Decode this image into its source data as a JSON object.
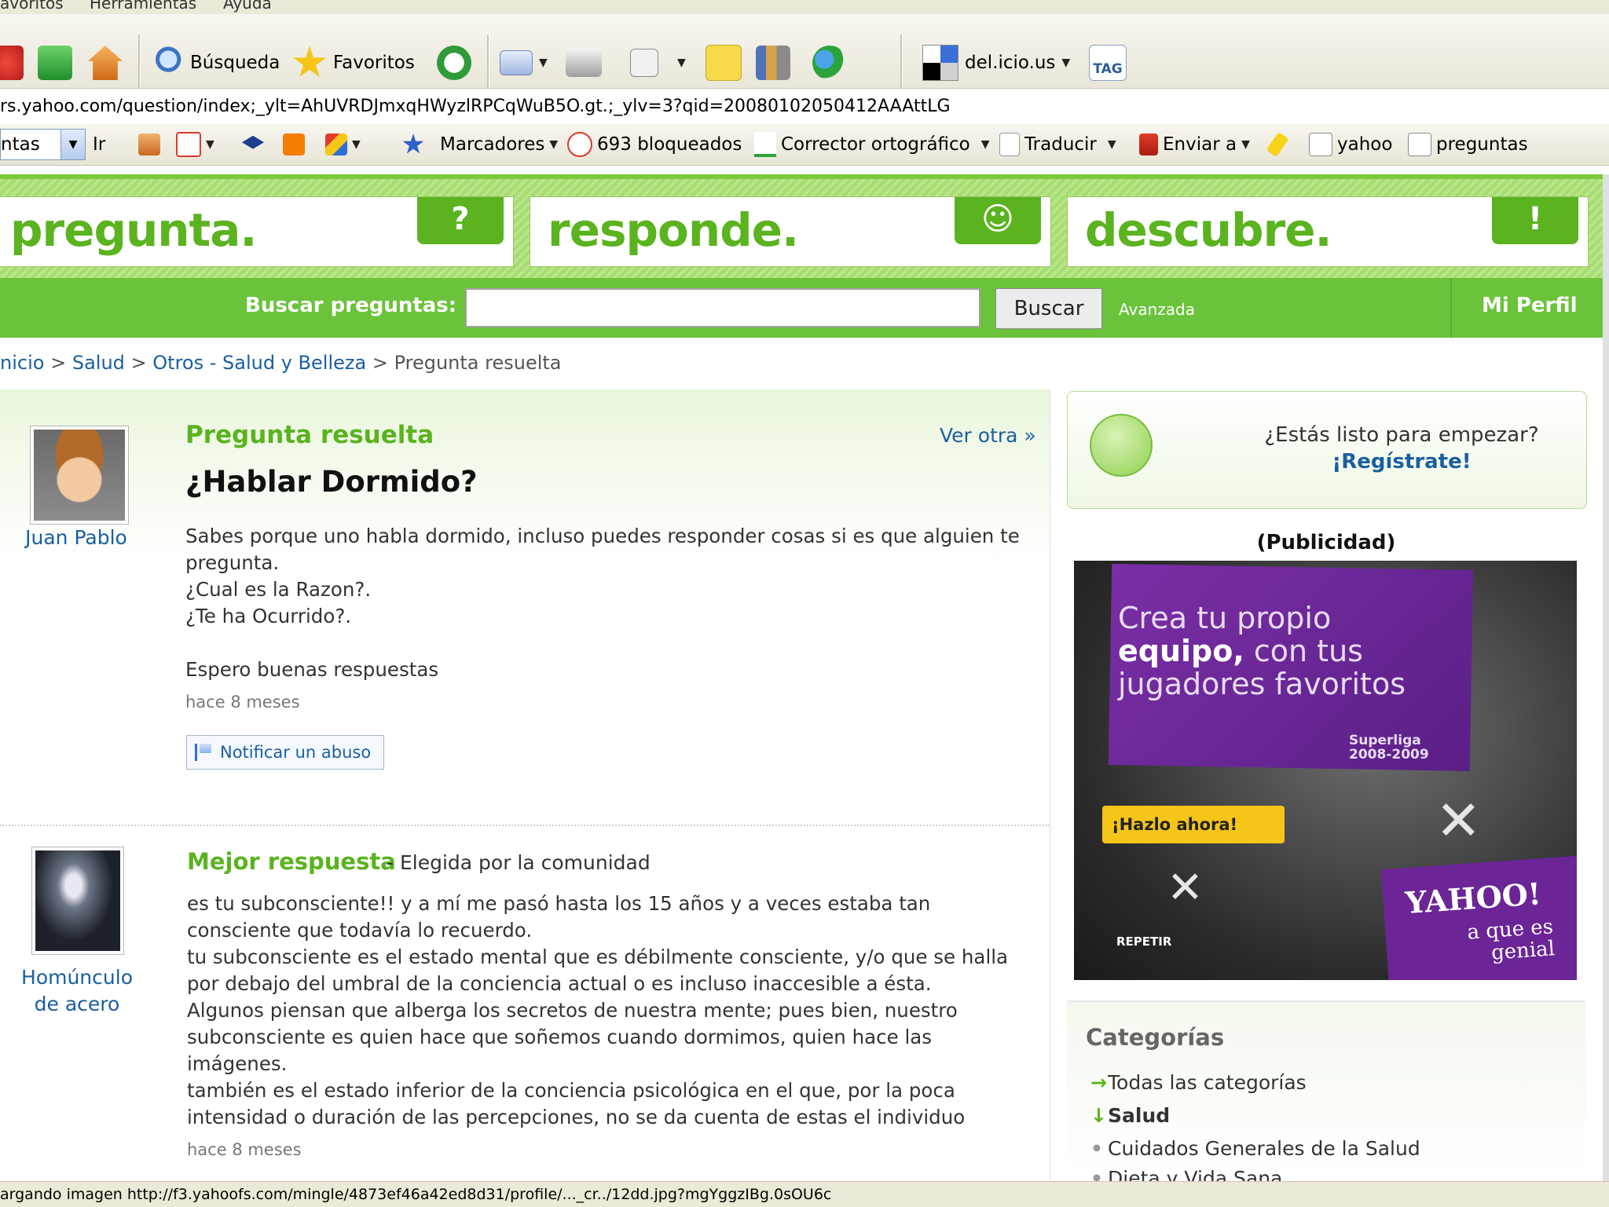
{
  "browser": {
    "menubar": {
      "items": [
        "avoritos",
        "Herramientas",
        "Ayuda"
      ]
    },
    "toolbar": {
      "search_label": "Búsqueda",
      "favorites_label": "Favoritos",
      "delicious_label": "del.icio.us",
      "tag_label": "TAG"
    },
    "address": "rs.yahoo.com/question/index;_ylt=AhUVRDJmxqHWyzlRPCqWuB5O.gt.;_ylv=3?qid=20080102050412AAAttLG",
    "links": {
      "dropdown_value": "ntas",
      "go_label": "Ir",
      "bookmarks_label": "Marcadores",
      "blocked_label": "693 bloqueados",
      "spell_label": "Corrector ortográfico",
      "translate_label": "Traducir",
      "send_label": "Enviar a",
      "search1_label": "yahoo",
      "search2_label": "preguntas"
    },
    "status": "argando imagen http://f3.yahoofs.com/mingle/4873ef46a42ed8d31/profile/..._cr../12dd.jpg?mgYggzIBg.0sOU6c"
  },
  "hero": {
    "word1": "pregunta.",
    "tag1": "?",
    "word2": "responde.",
    "tag2": "☺",
    "word3": "descubre.",
    "tag3": "!"
  },
  "search": {
    "label": "Buscar preguntas:",
    "value": "",
    "button": "Buscar",
    "advanced": "Avanzada",
    "profile": "Mi Perfil"
  },
  "breadcrumb": {
    "home": "nicio",
    "sep": ">",
    "cat1": "Salud",
    "cat2": "Otros - Salud y Belleza",
    "current": "Pregunta resuelta"
  },
  "question": {
    "user": "Juan Pablo",
    "status": "Pregunta resuelta",
    "ver_otra": "Ver otra »",
    "title": "¿Hablar Dormido?",
    "line1": "Sabes porque uno habla dormido, incluso puedes responder cosas si es que alguien te",
    "line2": "pregunta.",
    "line3": "¿Cual es la Razon?.",
    "line4": "¿Te ha Ocurrido?.",
    "line5": "Espero buenas respuestas",
    "time": "hace 8 meses",
    "report": "Notificar un abuso"
  },
  "answer": {
    "user_line1": "Homúnculo",
    "user_line2": "de acero",
    "label": "Mejor respuesta",
    "sub": "- Elegida por la comunidad",
    "lines": [
      "es tu subconsciente!! y a mí me pasó hasta los 15 años y a veces estaba tan",
      "consciente que todavía lo recuerdo.",
      "tu subconsciente es el estado mental que es débilmente consciente, y/o que se halla",
      "por debajo del umbral de la conciencia actual o es incluso inaccesible a ésta.",
      "Algunos piensan que alberga los secretos de nuestra mente; pues bien, nuestro",
      "subconsciente es quien hace que soñemos cuando dormimos, quien hace las",
      "imágenes.",
      "también es el estado inferior de la conciencia psicológica en el que, por la poca",
      "intensidad o duración de las percepciones, no se da cuenta de estas el individuo"
    ],
    "time": "hace 8 meses"
  },
  "sidebar": {
    "cta_question": "¿Estás listo para empezar?",
    "cta_register": "¡Regístrate!",
    "ad_label": "(Publicidad)",
    "ad": {
      "headline_a": "Crea tu propio",
      "headline_b": "equipo,",
      "headline_c": " con tus",
      "headline_d": "jugadores favoritos",
      "season_a": "Superliga",
      "season_b": "2008-2009",
      "cta": "¡Hazlo ahora!",
      "repeat": "REPETIR",
      "logo": "YAHOO!",
      "slogan_a": "a que es",
      "slogan_b": "genial"
    },
    "categories": {
      "title": "Categorías",
      "items": [
        "Todas las categorías",
        "Salud",
        "Cuidados Generales de la Salud",
        "Dieta y Vida Sana"
      ]
    }
  }
}
